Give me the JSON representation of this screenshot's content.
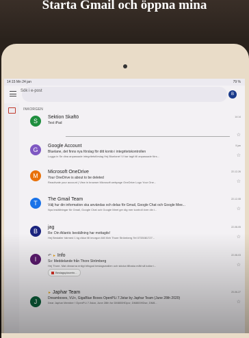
{
  "caption": "Starta Gmail och öppna mina",
  "status": {
    "time": "14:15",
    "date": "Mn 24 jan",
    "battery": "79 %"
  },
  "search": {
    "placeholder": "Sök i e-post"
  },
  "account": {
    "initial": "B"
  },
  "folder": {
    "label": "INKORGEN"
  },
  "emails": [
    {
      "initial": "S",
      "color": "#1e8e3e",
      "sender": "Sektion Skaftö",
      "subject": "Test iPad",
      "snippet": "",
      "date": "14:14"
    },
    {
      "initial": "G",
      "color": "#7e57c2",
      "sender": "Google Account",
      "subject": "Bluelane, det finns nya förslag för ditt konto i integritetskontrollen",
      "snippet": "Logga in Se dina anpassade integritetsförslag Hej Bluelane! Vi har tagit till anpassade förs...",
      "date": "5 jan"
    },
    {
      "initial": "M",
      "color": "#e8710a",
      "sender": "Microsoft OneDrive",
      "subject": "Your OneDrive is about to be deleted",
      "snippet": "Reactivate your account | View in browser Microsoft webpage OneDrive Logo Your One...",
      "date": "22-12-26"
    },
    {
      "initial": "T",
      "color": "#1a73e8",
      "sender": "The Gmail Team",
      "subject": "Välj hur din information ska användas och delas för Gmail, Google Chat och Google Mee...",
      "snippet": "Nya inställningar för Gmail, Google Chat och Google Meet ger dig mer kontroll över din i...",
      "date": "22-12-08"
    },
    {
      "initial": "B",
      "color": "#1a237e",
      "sender": "jag",
      "subject": "Re: Din Atlantic beställning har mottagits!",
      "snippet": "Hej Bestaller härmed 1 kg räkor till imorgon 6/8 Mvh Thore Strömberg Tel 0733081727...",
      "date": "22-08-05"
    },
    {
      "initial": "I",
      "color": "#5b1a6e",
      "sender": "Info",
      "subject": "Sv: Meddelande från Thore Strömberg",
      "snippet": "Hej Thore. Mat dinnarna enligt bifogad beslagsmallen och skicka tillbaka mått så kollar i...",
      "date": "22-08-03",
      "attachment": "Beslagsplacerin..."
    },
    {
      "initial": "J",
      "color": "#0b5f3a",
      "sender": "Japhar Team",
      "subject": "Dreamboxes, VU+, GigaBlue Boxes OpenPLi 7.3star by Japhar Team (June 28th 2020)",
      "snippet": "Dear Japhar Member ! OpenPLi 7.3star, June 28th for DM800HDpvr, DM800HDse, DM8...",
      "date": "20-06-27"
    }
  ]
}
